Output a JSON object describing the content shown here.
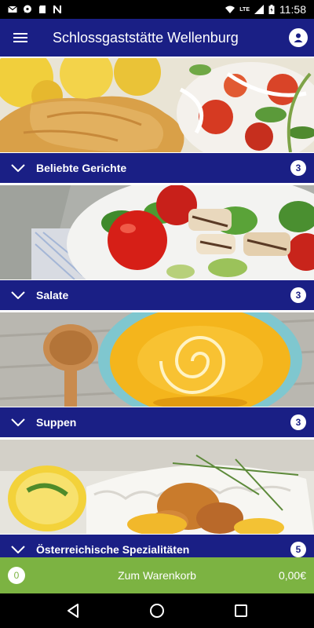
{
  "status_bar": {
    "lte_label": "LTE",
    "time": "11:58"
  },
  "app_bar": {
    "title": "Schlossgaststätte Wellenburg",
    "menu_icon": "hamburger-menu-icon",
    "profile_icon": "account-icon"
  },
  "categories": [
    {
      "label": "Beliebte Gerichte",
      "count": "3",
      "image": "schnitzel-potatoes-salad-photo"
    },
    {
      "label": "Salate",
      "count": "3",
      "image": "chicken-salad-photo"
    },
    {
      "label": "Suppen",
      "count": "3",
      "image": "pumpkin-soup-photo"
    },
    {
      "label": "Österreichische Spezialitäten",
      "count": "5",
      "image": "fried-chicken-basket-photo"
    }
  ],
  "cart": {
    "count": "0",
    "label": "Zum Warenkorb",
    "total": "0,00€"
  },
  "colors": {
    "brand_blue": "#1a1f85",
    "cart_green": "#7cb342"
  },
  "nav_bar": {
    "back_icon": "back-triangle-icon",
    "home_icon": "home-circle-icon",
    "recents_icon": "recents-square-icon"
  }
}
